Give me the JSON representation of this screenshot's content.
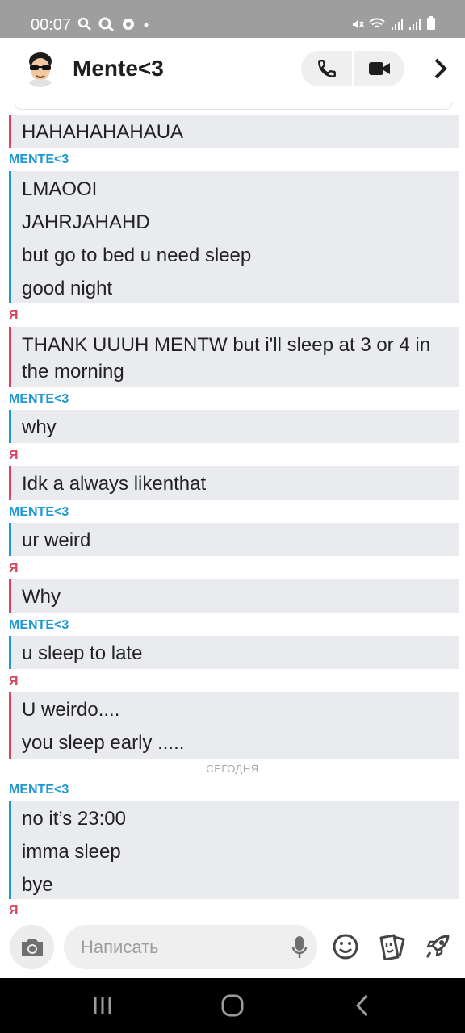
{
  "status_bar": {
    "time": "00:07",
    "left_icons": [
      "search-icon",
      "search-icon",
      "app-icon",
      "dot"
    ],
    "right_icons": [
      "mute-icon",
      "wifi-icon",
      "signal-icon",
      "signal-icon",
      "battery-icon"
    ]
  },
  "header": {
    "contact_name": "Mente<3",
    "avatar": "bitmoji-avatar",
    "call_icon": "phone-icon",
    "video_icon": "video-icon",
    "more_icon": "chevron-right-icon"
  },
  "chat": {
    "senders": {
      "me": "Я",
      "them": "MENTE<3"
    },
    "blocks": [
      {
        "type": "group",
        "from": "me",
        "sender_visible": false,
        "lines": [
          "HAHAHAHAHAUA"
        ]
      },
      {
        "type": "group",
        "from": "them",
        "sender": "MENTE<3",
        "lines": [
          "LMAOOI",
          "JAHRJAHAHD",
          "but go to bed u need sleep",
          "good night"
        ]
      },
      {
        "type": "group",
        "from": "me",
        "sender": "Я",
        "lines": [
          "THANK UUUH MENTW but i'll sleep at 3 or 4 in",
          "the morning"
        ]
      },
      {
        "type": "group",
        "from": "them",
        "sender": "MENTE<3",
        "lines": [
          "why"
        ]
      },
      {
        "type": "group",
        "from": "me",
        "sender": "Я",
        "lines": [
          "Idk a always likenthat"
        ]
      },
      {
        "type": "group",
        "from": "them",
        "sender": "MENTE<3",
        "lines": [
          "ur weird"
        ]
      },
      {
        "type": "group",
        "from": "me",
        "sender": "Я",
        "lines": [
          "Why"
        ]
      },
      {
        "type": "group",
        "from": "them",
        "sender": "MENTE<3",
        "lines": [
          "u sleep to late"
        ]
      },
      {
        "type": "group",
        "from": "me",
        "sender": "Я",
        "lines": [
          "U weirdo....",
          "you sleep early ....."
        ]
      },
      {
        "type": "divider",
        "text": "СЕГОДНЯ"
      },
      {
        "type": "group",
        "from": "them",
        "sender": "MENTE<3",
        "lines": [
          "no it’s 23:00",
          "imma sleep",
          "bye"
        ]
      },
      {
        "type": "partial-sender",
        "from": "me",
        "sender": "Я"
      }
    ]
  },
  "composer": {
    "placeholder": "Написать",
    "camera_icon": "camera-icon",
    "mic_icon": "microphone-icon",
    "emoji_icon": "emoji-icon",
    "stickers_icon": "stickers-icon",
    "games_icon": "rocket-icon"
  },
  "nav_bar": {
    "recent_icon": "recent-apps-icon",
    "home_icon": "home-icon",
    "back_icon": "back-icon"
  }
}
